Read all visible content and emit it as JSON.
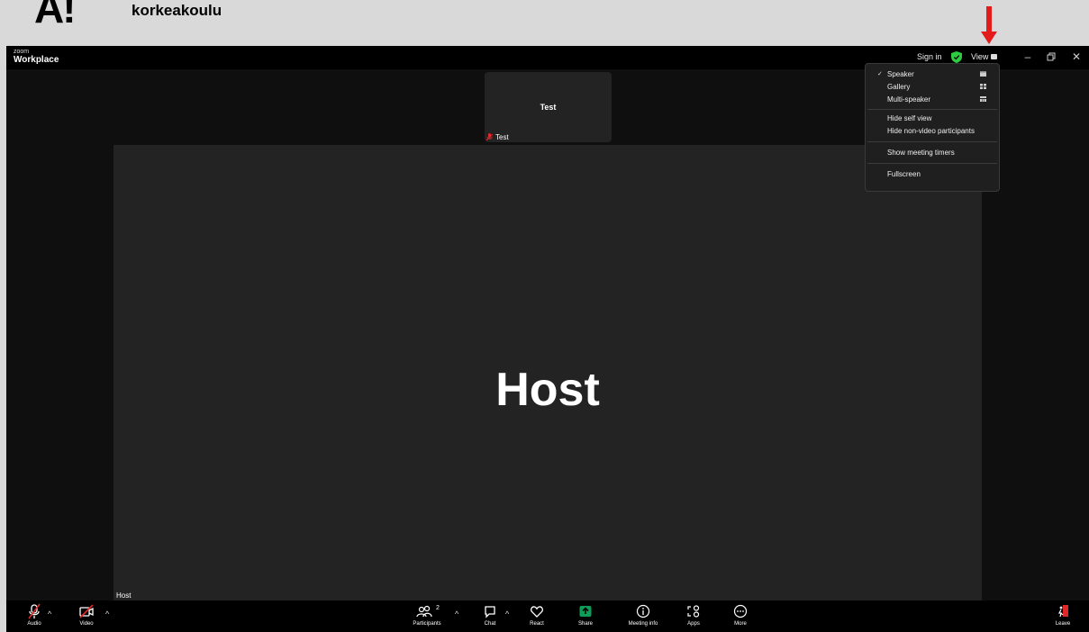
{
  "header": {
    "logo_mark": "A!",
    "logo_text": "korkeakoulu"
  },
  "window": {
    "brand_small": "zoom",
    "brand_big": "Workplace",
    "sign_in": "Sign in",
    "view_label": "View"
  },
  "thumbnail": {
    "name": "Test",
    "label": "Test"
  },
  "speaker": {
    "name": "Host",
    "label": "Host"
  },
  "view_menu": {
    "items": [
      {
        "label": "Speaker",
        "checked": true,
        "icon": "speaker-layout-icon"
      },
      {
        "label": "Gallery",
        "checked": false,
        "icon": "gallery-grid-icon"
      },
      {
        "label": "Multi-speaker",
        "checked": false,
        "icon": "multi-speaker-icon"
      },
      {
        "label": "Hide self view"
      },
      {
        "label": "Hide non-video participants"
      },
      {
        "label": "Show meeting timers"
      },
      {
        "label": "Fullscreen"
      }
    ],
    "check_mark": "✓"
  },
  "toolbar": {
    "audio": "Audio",
    "video": "Video",
    "participants": "Participants",
    "participants_count": "2",
    "chat": "Chat",
    "react": "React",
    "share": "Share",
    "meeting_info": "Meeting info",
    "apps": "Apps",
    "more": "More",
    "leave": "Leave"
  },
  "colors": {
    "share_green": "#0e9d58",
    "shield_green": "#2ecc40",
    "arrow_red": "#e31b1b",
    "muted_red": "#e02828"
  }
}
